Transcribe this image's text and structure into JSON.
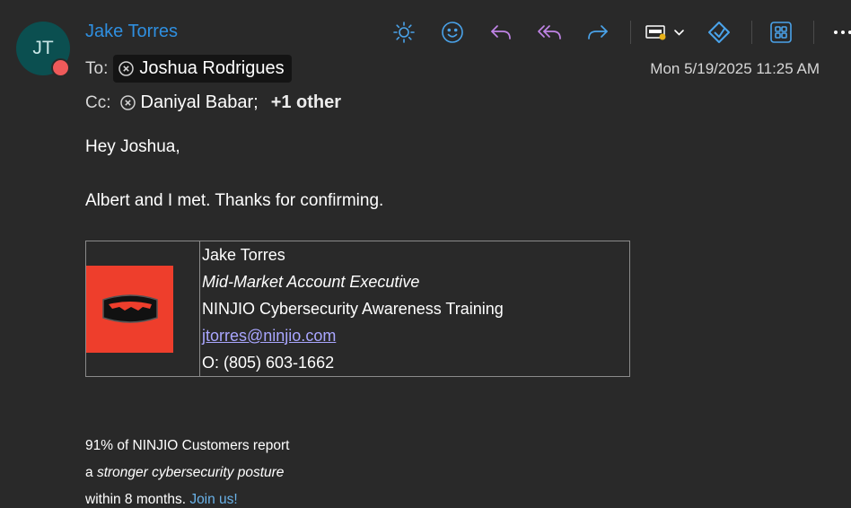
{
  "sender": {
    "initials": "JT",
    "name": "Jake Torres"
  },
  "recipients": {
    "to_label": "To:",
    "to": [
      "Joshua Rodrigues"
    ],
    "cc_label": "Cc:",
    "cc": [
      "Daniyal Babar;"
    ],
    "cc_more": "+1 other"
  },
  "date": "Mon 5/19/2025 11:25 AM",
  "toolbar": {
    "icons": [
      "brightness-icon",
      "emoji-icon",
      "reply-icon",
      "reply-all-icon",
      "forward-icon",
      "immersive-reader-icon",
      "viva-insights-icon",
      "apps-icon",
      "more-icon"
    ]
  },
  "message": {
    "greeting": "Hey Joshua,",
    "line1": "Albert and I met. Thanks for confirming."
  },
  "signature": {
    "name": "Jake Torres",
    "title": "Mid-Market Account Executive",
    "company": "NINJIO Cybersecurity Awareness Training",
    "email": "jtorres@ninjio.com",
    "phone": "O: (805) 603-1662"
  },
  "footer": {
    "line1": "91% of NINJIO Customers report",
    "line2_prefix": "a ",
    "line2_italic": "stronger cybersecurity posture",
    "line3": "within 8 months.",
    "join": "Join us!"
  },
  "colors": {
    "accent": "#2f8fe0",
    "reply": "#c084e6",
    "logo_bg": "#ee3e2c",
    "link": "#a9a6ff"
  }
}
